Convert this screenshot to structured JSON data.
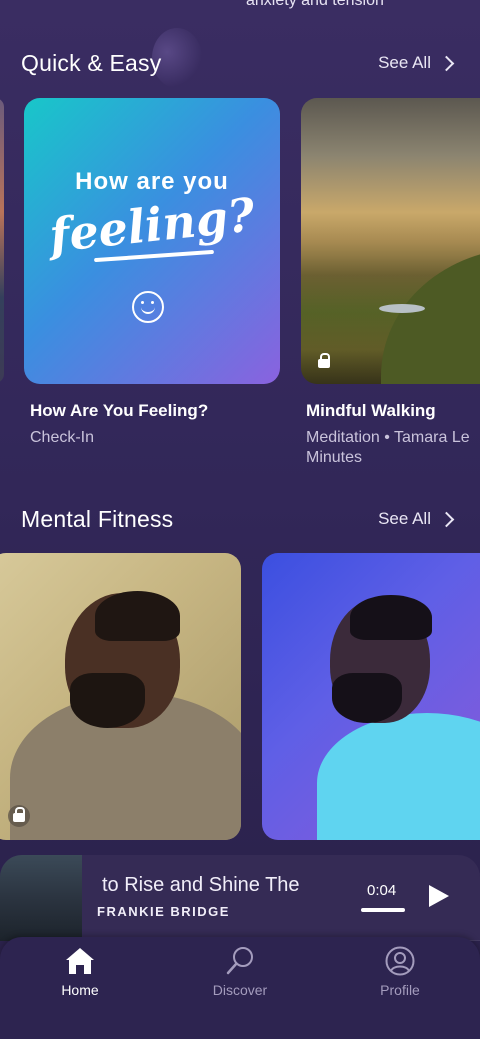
{
  "top_snippet": "anxiety and tension",
  "sections": {
    "quick": {
      "title": "Quick & Easy",
      "see_all": "See All"
    },
    "mental": {
      "title": "Mental Fitness",
      "see_all": "See All"
    }
  },
  "cards": {
    "feeling": {
      "art_line1": "How are you",
      "art_line2": "feeling?",
      "title": "How Are You Feeling?",
      "subtitle": "Check-In"
    },
    "walking": {
      "title": "Mindful Walking",
      "subtitle_line1": "Meditation • Tamara Le",
      "subtitle_line2": "Minutes"
    }
  },
  "player": {
    "title": "to Rise and Shine       The",
    "artist": "FRANKIE BRIDGE",
    "time": "0:04"
  },
  "tabs": [
    {
      "label": "Home",
      "active": true,
      "icon": "home-icon"
    },
    {
      "label": "Discover",
      "active": false,
      "icon": "discover-icon"
    },
    {
      "label": "Profile",
      "active": false,
      "icon": "profile-icon"
    }
  ],
  "colors": {
    "background": "#33285a",
    "tab_active": "#ffffff",
    "tab_inactive": "#a49cbd"
  }
}
